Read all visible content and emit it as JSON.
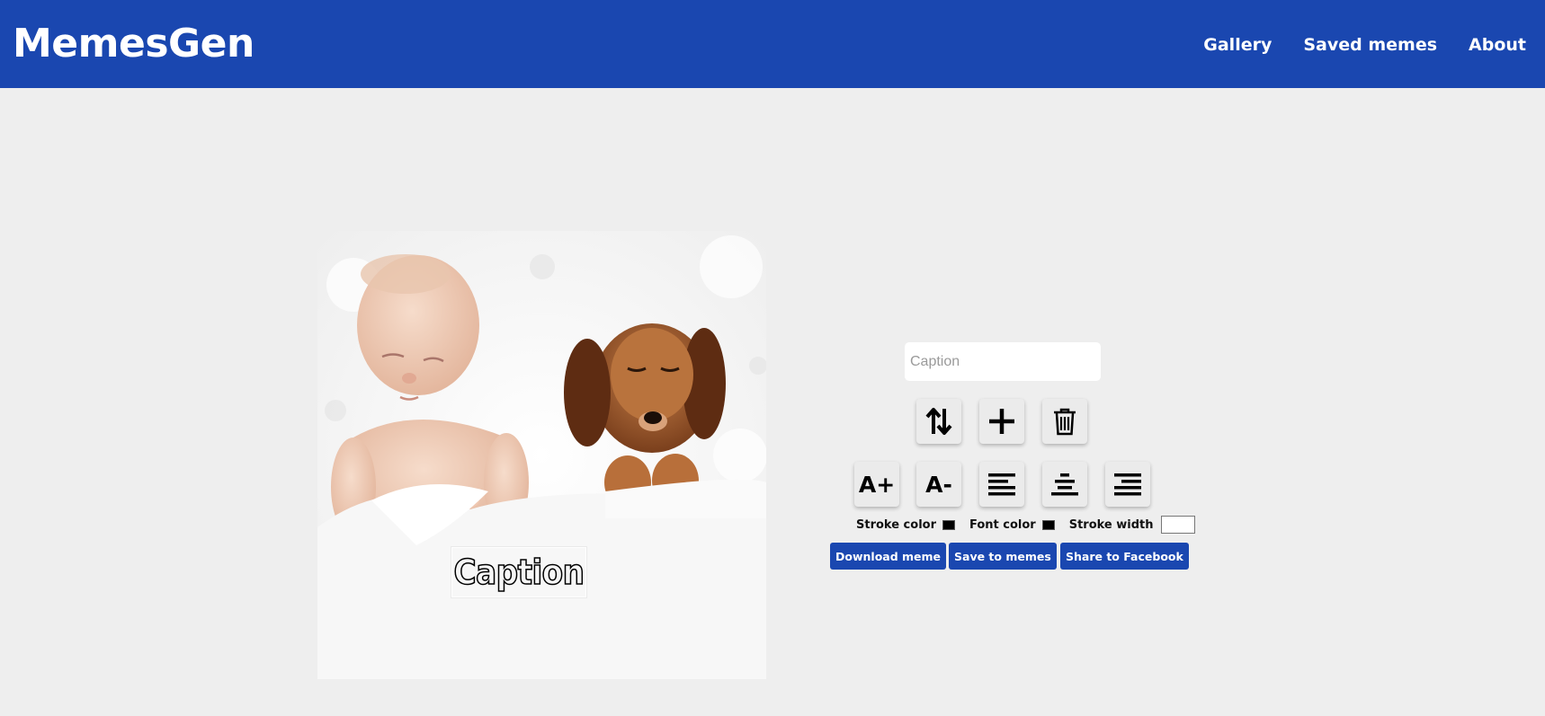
{
  "header": {
    "logo": "MemesGen",
    "nav": [
      "Gallery",
      "Saved memes",
      "About"
    ]
  },
  "canvas": {
    "caption_text": "Caption",
    "image_description_icon": "baby-and-puppy-photo"
  },
  "editor": {
    "caption_placeholder": "Caption",
    "caption_value": "",
    "buttons": {
      "switch_line": "swap-vertical-icon",
      "add_line": "plus-icon",
      "delete_line": "trash-icon",
      "increase_font": "A+",
      "decrease_font": "A-",
      "align_left": "align-left-icon",
      "align_center": "align-center-icon",
      "align_right": "align-right-icon"
    },
    "stroke_color_label": "Stroke color",
    "font_color_label": "Font color",
    "stroke_width_label": "Stroke width",
    "stroke_color": "#000000",
    "font_color": "#000000",
    "stroke_width_value": ""
  },
  "actions": {
    "download": "Download meme",
    "save": "Save to memes",
    "share": "Share to Facebook"
  },
  "colors": {
    "brand": "#1a47b0",
    "background": "#eeeeee"
  }
}
